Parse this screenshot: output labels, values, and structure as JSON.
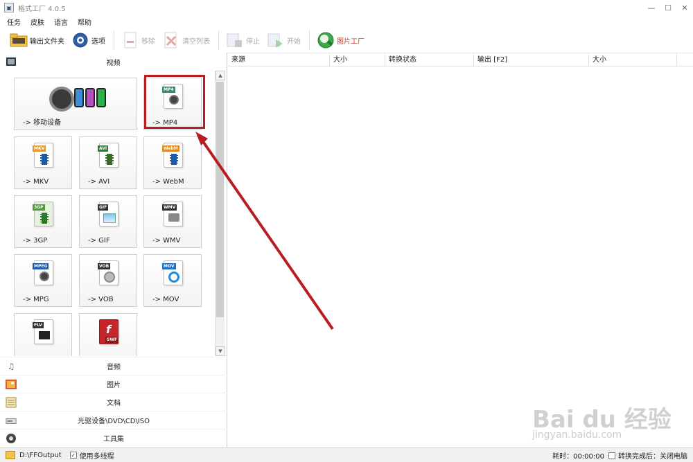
{
  "window": {
    "title": "格式工厂 4.0.5",
    "app_icon": "format-factory-icon"
  },
  "menu": [
    "任务",
    "皮肤",
    "语言",
    "帮助"
  ],
  "toolbar": {
    "output_folder": "输出文件夹",
    "options": "选项",
    "remove": "移除",
    "clear_list": "清空列表",
    "stop": "停止",
    "start": "开始",
    "picture_factory": "图片工厂"
  },
  "left": {
    "video_header": "视频",
    "tiles": [
      {
        "label": "-> 移动设备",
        "badge": ""
      },
      {
        "label": "-> MP4",
        "badge": "MP4"
      },
      {
        "label": "-> MKV",
        "badge": "MKV"
      },
      {
        "label": "-> AVI",
        "badge": "AVI"
      },
      {
        "label": "-> WebM",
        "badge": "WebM"
      },
      {
        "label": "-> 3GP",
        "badge": "3GP"
      },
      {
        "label": "-> GIF",
        "badge": "GIF"
      },
      {
        "label": "-> WMV",
        "badge": "WMV"
      },
      {
        "label": "-> MPG",
        "badge": "MPEG"
      },
      {
        "label": "-> VOB",
        "badge": "VOB"
      },
      {
        "label": "-> MOV",
        "badge": "MOV"
      },
      {
        "label": "",
        "badge": "FLV"
      },
      {
        "label": "",
        "badge": "SWF"
      }
    ],
    "categories": [
      "音频",
      "图片",
      "文档",
      "光驱设备\\DVD\\CD\\ISO",
      "工具集"
    ]
  },
  "list": {
    "columns": [
      "来源",
      "大小",
      "转换状态",
      "输出 [F2]",
      "大小"
    ]
  },
  "status": {
    "output_path": "D:\\FFOutput",
    "multithread": "使用多线程",
    "elapsed": "耗时：00:00:00",
    "after_convert": "转换完成后：关闭电脑"
  },
  "colors": {
    "annotation_red": "#b81d22",
    "accent_blue": "#1e5aa8"
  },
  "watermark": {
    "brand": "Bai du 经验",
    "url": "jingyan.baidu.com"
  }
}
